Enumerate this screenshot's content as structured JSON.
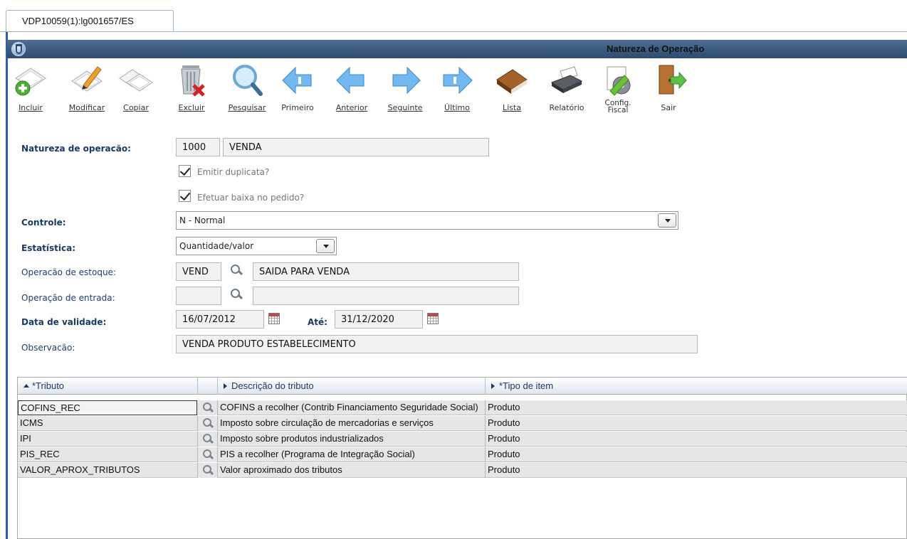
{
  "tab": {
    "label": "VDP10059(1):lg001657/ES"
  },
  "window": {
    "title": "Natureza de Operação"
  },
  "toolbar": {
    "incluir": "Incluir",
    "modificar": "Modificar",
    "copiar": "Copiar",
    "excluir": "Excluir",
    "pesquisar": "Pesquisar",
    "primeiro": "Primeiro",
    "anterior": "Anterior",
    "seguinte": "Seguinte",
    "ultimo": "Último",
    "lista": "Lista",
    "relatorio": "Relatório",
    "config_fiscal_1": "Config.",
    "config_fiscal_2": "Fiscal",
    "sair": "Sair"
  },
  "form": {
    "natureza_label": "Natureza de operacão:",
    "natureza_code": "1000",
    "natureza_desc": "VENDA",
    "emitir_duplicata": "Emitir duplicata?",
    "efetuar_baixa": "Efetuar baixa no pedido?",
    "controle_label": "Controle:",
    "controle_value": "N - Normal",
    "estatistica_label": "Estatística:",
    "estatistica_value": "Quantidade/valor",
    "op_estoque_label": "Operacão de estoque:",
    "op_estoque_code": "VEND",
    "op_estoque_desc": "SAIDA PARA VENDA",
    "op_entrada_label": "Operação de entrada:",
    "op_entrada_code": "",
    "op_entrada_desc": "",
    "validade_label": "Data de validade:",
    "validade_de": "16/07/2012",
    "ate_label": "Até:",
    "validade_ate": "31/12/2020",
    "observacao_label": "Observacão:",
    "observacao_value": "VENDA PRODUTO ESTABELECIMENTO"
  },
  "grid": {
    "headers": {
      "tributo": "*Tributo",
      "descricao": "Descrição do tributo",
      "tipo": "*Tipo de item"
    },
    "rows": [
      {
        "tributo": "COFINS_REC",
        "descricao": "COFINS a recolher (Contrib Financiamento Seguridade Social)",
        "tipo": "Produto"
      },
      {
        "tributo": "ICMS",
        "descricao": "Imposto sobre circulação de mercadorias e serviços",
        "tipo": "Produto"
      },
      {
        "tributo": "IPI",
        "descricao": "Imposto sobre produtos industrializados",
        "tipo": "Produto"
      },
      {
        "tributo": "PIS_REC",
        "descricao": "PIS a recolher (Programa de Integração Social)",
        "tipo": "Produto"
      },
      {
        "tributo": "VALOR_APROX_TRIBUTOS",
        "descricao": "Valor aproximado dos tributos",
        "tipo": "Produto"
      }
    ]
  }
}
